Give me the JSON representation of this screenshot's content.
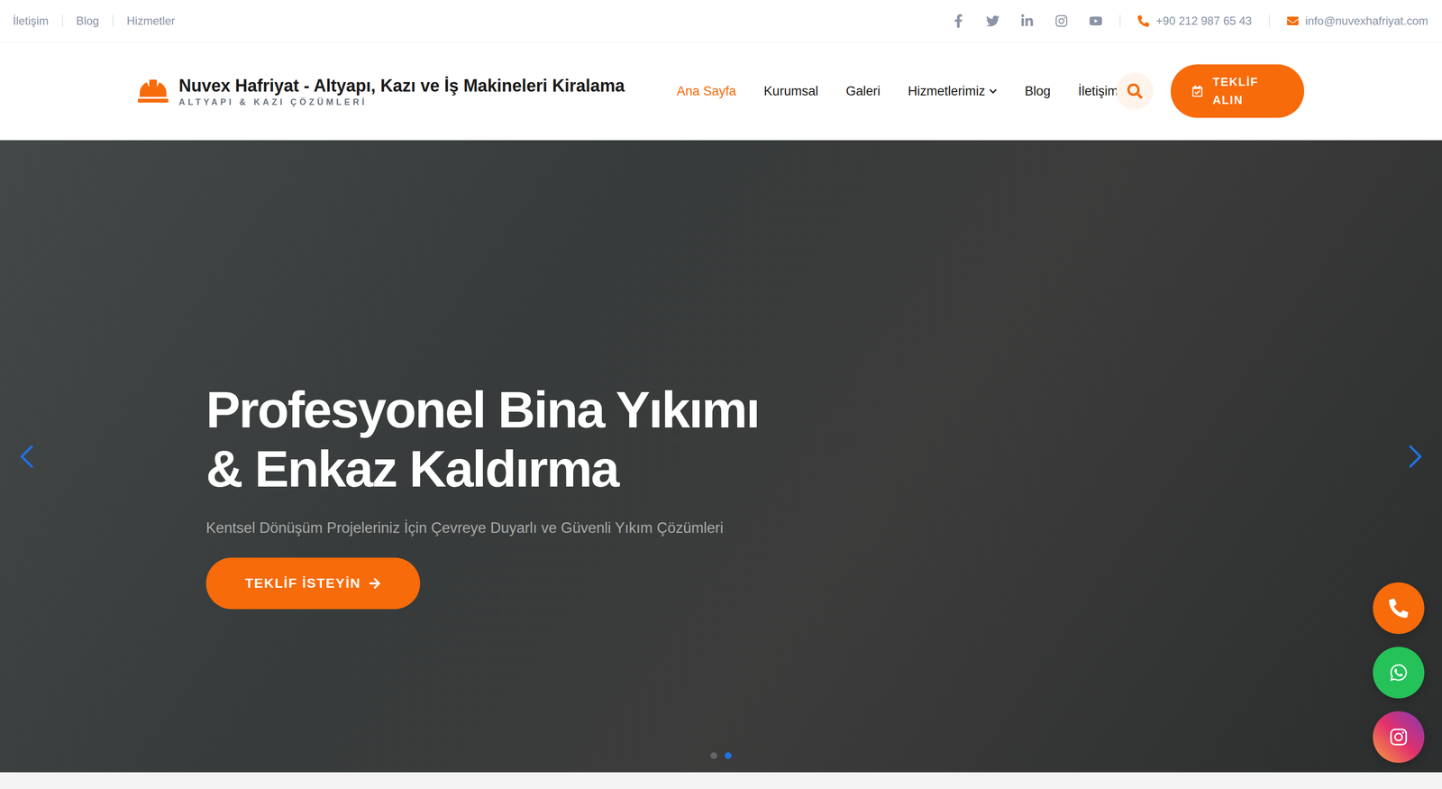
{
  "topbar": {
    "links": [
      {
        "label": "İletişim"
      },
      {
        "label": "Blog"
      },
      {
        "label": "Hizmetler"
      }
    ],
    "phone": "+90 212 987 65 43",
    "email": "info@nuvexhafriyat.com"
  },
  "brand": {
    "title": "Nuvex Hafriyat - Altyapı, Kazı ve İş Makineleri Kiralama",
    "tagline": "ALTYAPI & KAZI ÇÖZÜMLERİ"
  },
  "nav": [
    {
      "label": "Ana Sayfa",
      "selected": true,
      "dropdown": false
    },
    {
      "label": "Kurumsal",
      "selected": false,
      "dropdown": false
    },
    {
      "label": "Galeri",
      "selected": false,
      "dropdown": false
    },
    {
      "label": "Hizmetlerimiz",
      "selected": false,
      "dropdown": true
    },
    {
      "label": "Blog",
      "selected": false,
      "dropdown": false
    },
    {
      "label": "İletişim",
      "selected": false,
      "dropdown": false
    }
  ],
  "cta": {
    "label": "TEKLİF ALIN"
  },
  "hero": {
    "title_lines": [
      "Profesyonel Bina Yıkımı",
      "& Enkaz Kaldırma"
    ],
    "subtitle": "Kentsel Dönüşüm Projeleriniz İçin Çevreye Duyarlı ve Güvenli Yıkım Çözümleri",
    "button": "TEKLİF İSTEYİN"
  },
  "slider": {
    "dots": [
      {
        "selected": false
      },
      {
        "selected": true
      }
    ]
  }
}
